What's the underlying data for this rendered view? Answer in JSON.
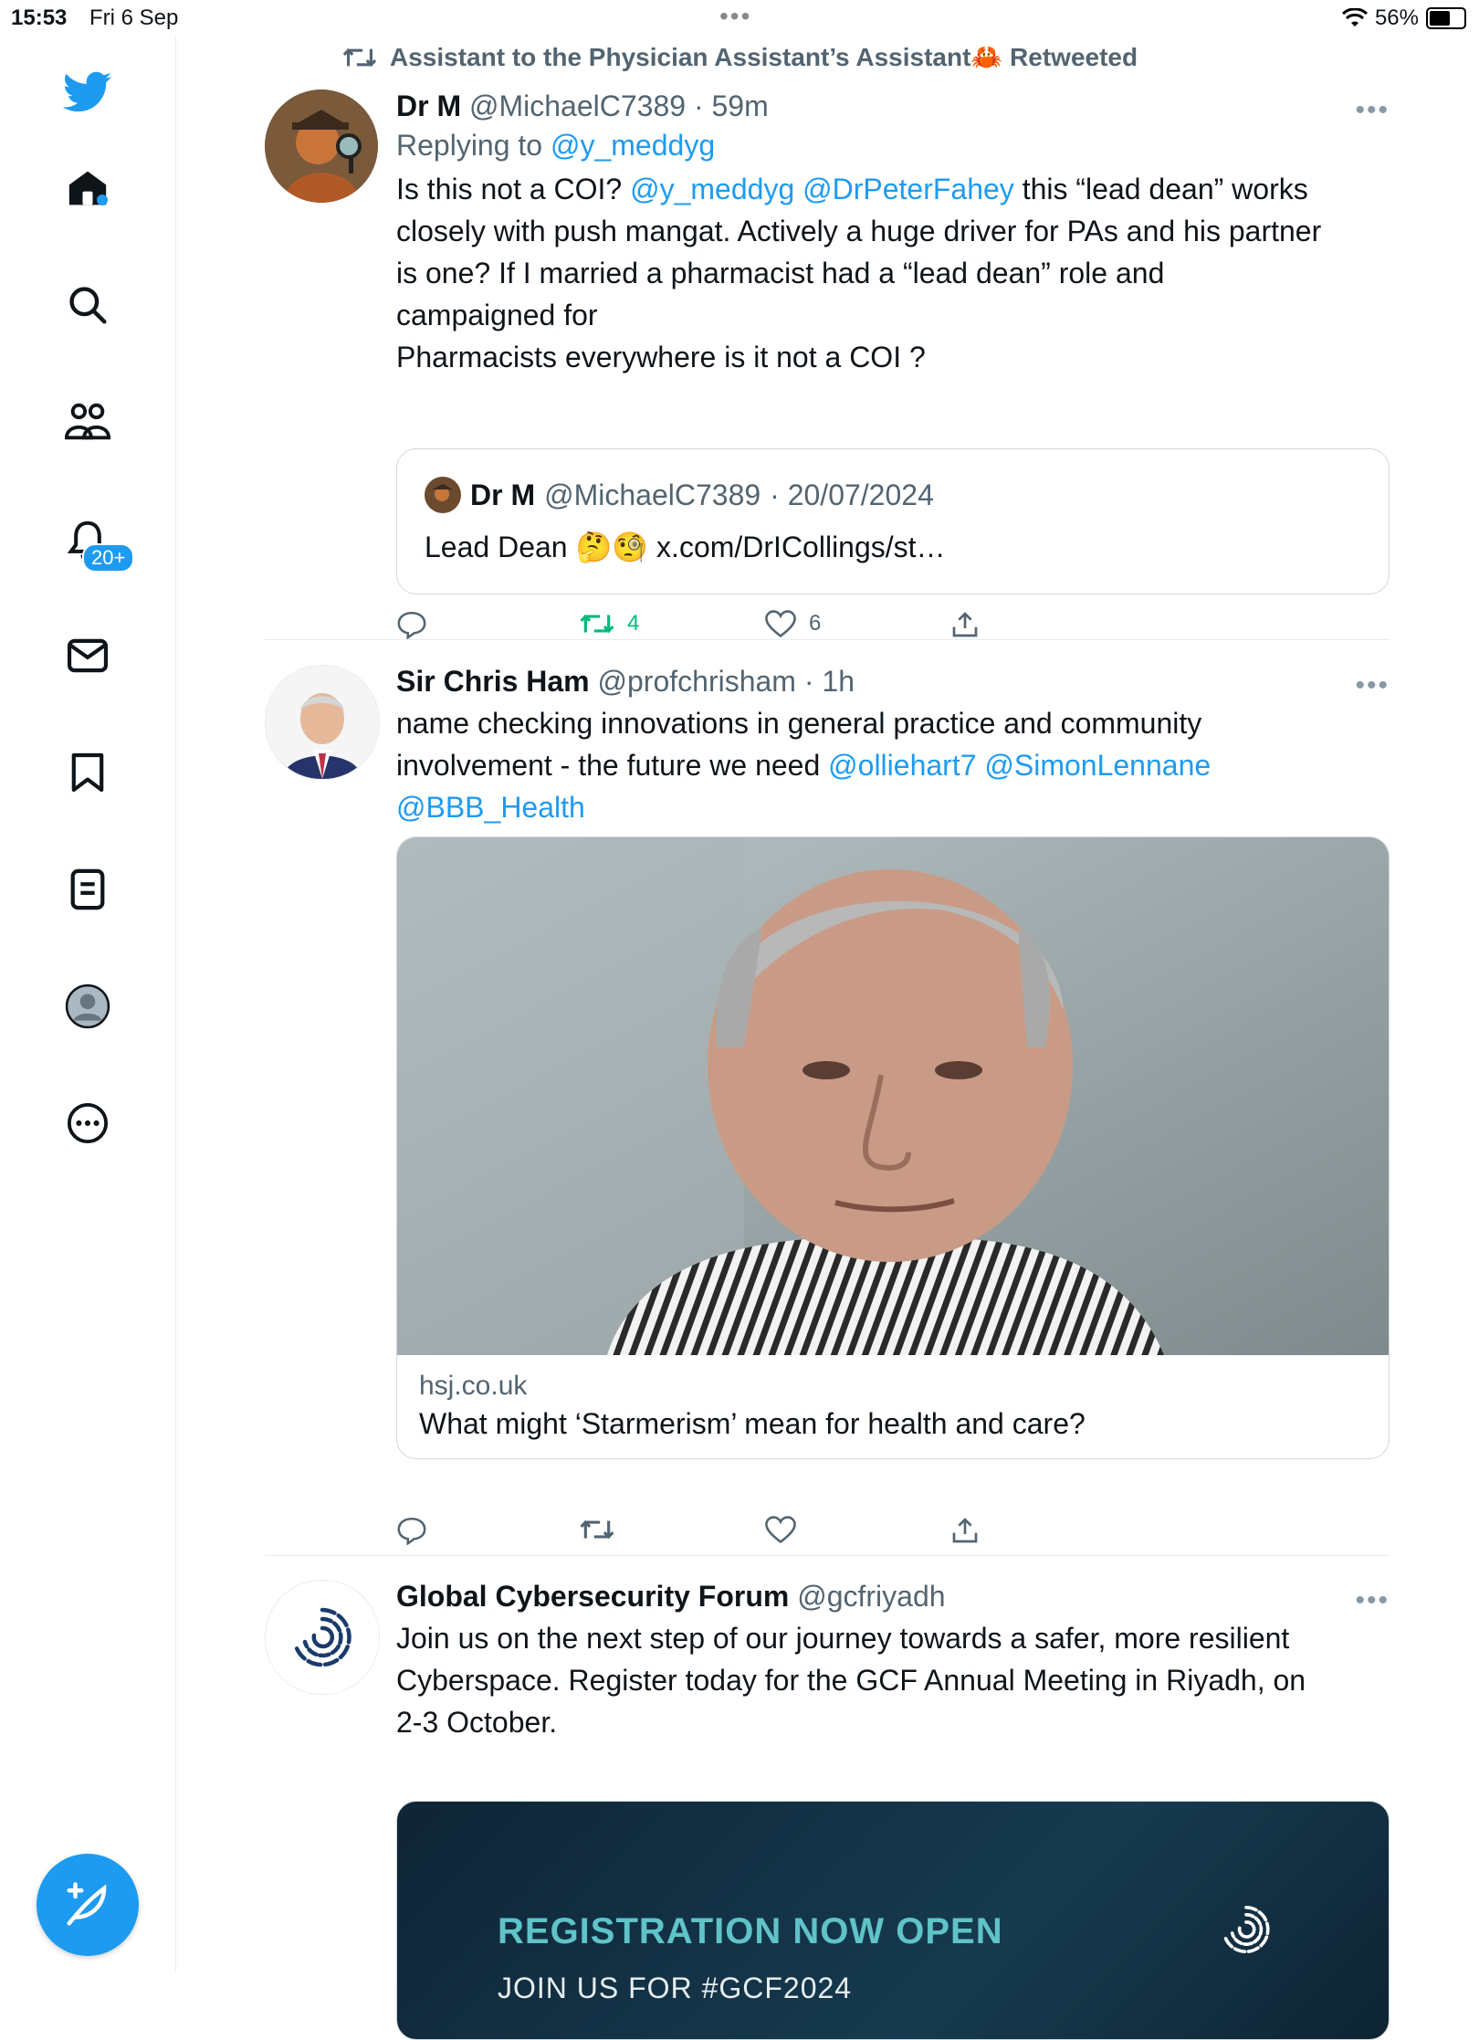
{
  "status": {
    "time": "15:53",
    "date": "Fri 6 Sep",
    "battery": "56%"
  },
  "sidebar": {
    "icons": [
      "twitter-logo",
      "home-icon",
      "search-icon",
      "communities-icon",
      "notifications-icon",
      "messages-icon",
      "bookmark-icon",
      "lists-icon",
      "profile-icon",
      "more-icon"
    ],
    "notification_badge": "20+"
  },
  "retweet_line": {
    "text": "Assistant to the Physician Assistant’s Assistant🦀 Retweeted"
  },
  "tweet1": {
    "name": "Dr M",
    "handle": "@MichaelC7389",
    "time": "· 59m",
    "reply_prefix": "Replying to",
    "reply_to": "@y_meddyg",
    "line1_a": "Is this not a COI? ",
    "mention1": "@y_meddyg",
    "mention2": "@DrPeterFahey",
    "line1_b": " this “lead dean” works",
    "line2": "closely with push mangat. Actively a huge driver for PAs and his partner",
    "line3": "is one? If I married a pharmacist had a “lead dean” role and",
    "line4": "campaigned for",
    "line5": "Pharmacists everywhere is it not a COI ?",
    "quote": {
      "name": "Dr M",
      "handle": "@MichaelC7389",
      "time": "· 20/07/2024",
      "text": "Lead Dean 🤔🧐 x.com/DrICollings/st…"
    },
    "retweets": "4",
    "likes": "6"
  },
  "tweet2": {
    "name": "Sir Chris Ham",
    "handle": "@profchrisham",
    "time": "· 1h",
    "line1": "name checking innovations in general practice and community",
    "line2_a": "involvement - the future we need ",
    "mention1": "@olliehart7",
    "mention2": "@SimonLennane",
    "mention3": "@BBB_Health",
    "card": {
      "domain": "hsj.co.uk",
      "title": "What might ‘Starmerism’ mean for health and care?"
    }
  },
  "tweet3": {
    "name": "Global Cybersecurity Forum",
    "handle": "@gcfriyadh",
    "line1": "Join us on the next step of our journey towards a safer, more resilient",
    "line2": "Cyberspace. Register today for the GCF Annual Meeting in Riyadh, on",
    "line3": "2-3 October.",
    "banner": {
      "headline": "REGISTRATION NOW OPEN",
      "sub": "JOIN US FOR #GCF2024"
    }
  }
}
